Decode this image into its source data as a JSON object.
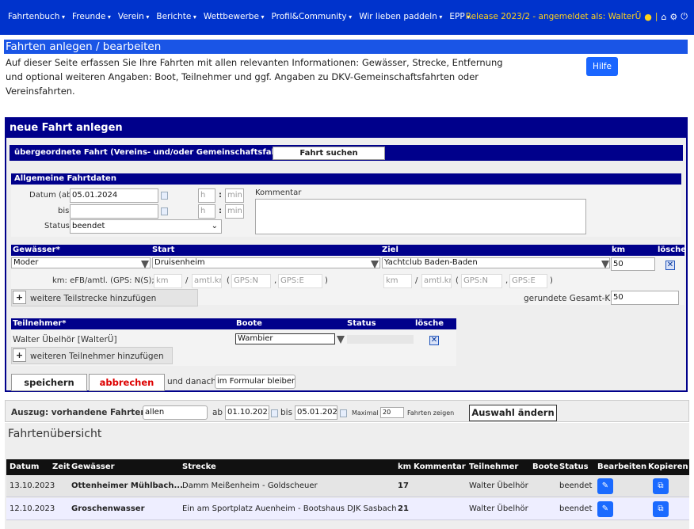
{
  "nav": {
    "items": [
      "Fahrtenbuch",
      "Freunde",
      "Verein",
      "Berichte",
      "Wettbewerbe",
      "Profil&Community",
      "Wir lieben paddeln",
      "EPP"
    ],
    "release": "Release 2023/2 - angemeldet als: WalterÜ",
    "separator": "|"
  },
  "page": {
    "title": "Fahrten anlegen / bearbeiten",
    "intro": "Auf dieser Seite erfassen Sie Ihre Fahrten mit allen relevanten Informationen: Gewässer, Strecke, Entfernung und optional weiteren Angaben: Boot, Teilnehmer und ggf. Angaben zu DKV-Gemeinschaftsfahrten oder Vereinsfahrten.",
    "help": "Hilfe"
  },
  "newtrip": {
    "heading": "neue Fahrt anlegen",
    "parent_label": "übergeordnete Fahrt (Vereins- und/oder Gemeinschaftsfahrt)",
    "parent_button": "Fahrt suchen",
    "general_label": "Allgemeine Fahrtdaten",
    "date_label": "Datum (ab)*",
    "date_value": "05.01.2024",
    "until_label": "bis",
    "until_value": "",
    "h_placeholder": "h",
    "min_placeholder": "min",
    "colon": ":",
    "comment_label": "Kommentar",
    "status_label": "Status",
    "status_value": "beendet",
    "water_head": "Gewässer*",
    "start_head": "Start",
    "goal_head": "Ziel",
    "km_head": "km",
    "delete_head": "lösche",
    "water_value": "Moder",
    "start_value": "Druisenheim",
    "goal_value": "Yachtclub Baden-Baden",
    "km_value": "50",
    "km_info_label": "km: eFB/amtl. (GPS: N(S);E(W))",
    "km_ph": "km",
    "slash": "/",
    "amtl_ph": "amtl.km",
    "open_paren": "(",
    "gpsn_ph": "GPS:N",
    "comma": ",",
    "gpse_ph": "GPS:E",
    "close_paren": ")",
    "add_segment": "weitere Teilstrecke hinzufügen",
    "total_km_label": "gerundete Gesamt-Kilometer:",
    "total_km_value": "50",
    "participant_head": "Teilnehmer*",
    "boats_head": "Boote",
    "status_head": "Status",
    "p_delete_head": "lösche",
    "participant_name": "Walter Übelhör [WalterÜ]",
    "boat_value": "Wambier",
    "add_participant": "weiteren Teilnehmer hinzufügen",
    "save": "speichern",
    "cancel": "abbrechen",
    "after_label": "und danach:",
    "after_value": "im Formular bleiben"
  },
  "filter": {
    "label": "Auszug: vorhandene Fahrten",
    "from_label": "von",
    "from_value": "allen",
    "ab_label": "ab",
    "ab_value": "01.10.2023",
    "bis_label": "bis",
    "bis_value": "05.01.2024",
    "max_label": "Maximal",
    "max_value": "20",
    "show_label": "Fahrten zeigen",
    "button": "Auswahl ändern"
  },
  "overview": {
    "title": "Fahrtenübersicht",
    "columns": [
      "Datum",
      "Zeit",
      "Gewässer",
      "Strecke",
      "km",
      "Kommentar",
      "Teilnehmer",
      "Boote",
      "Status",
      "Bearbeiten",
      "Kopieren"
    ],
    "rows": [
      {
        "date": "13.10.2023",
        "water": "Ottenheimer Mühlbach...",
        "route": "Damm Meißenheim - Goldscheuer",
        "km": "17",
        "participant": "Walter Übelhör",
        "status": "beendet"
      },
      {
        "date": "12.10.2023",
        "water": "Groschenwasser",
        "route": "Ein am Sportplatz Auenheim - Bootshaus DJK Sasbach",
        "km": "21",
        "participant": "Walter Übelhör",
        "status": "beendet"
      }
    ]
  },
  "colors": {
    "nav": "#0033cc",
    "panel": "#00008b",
    "accent": "#1a66ff",
    "release": "#ffd21a"
  },
  "icons": [
    "user-icon",
    "home-icon",
    "settings-icon",
    "power-icon",
    "calendar-icon",
    "delete-icon",
    "edit-icon",
    "copy-icon"
  ]
}
